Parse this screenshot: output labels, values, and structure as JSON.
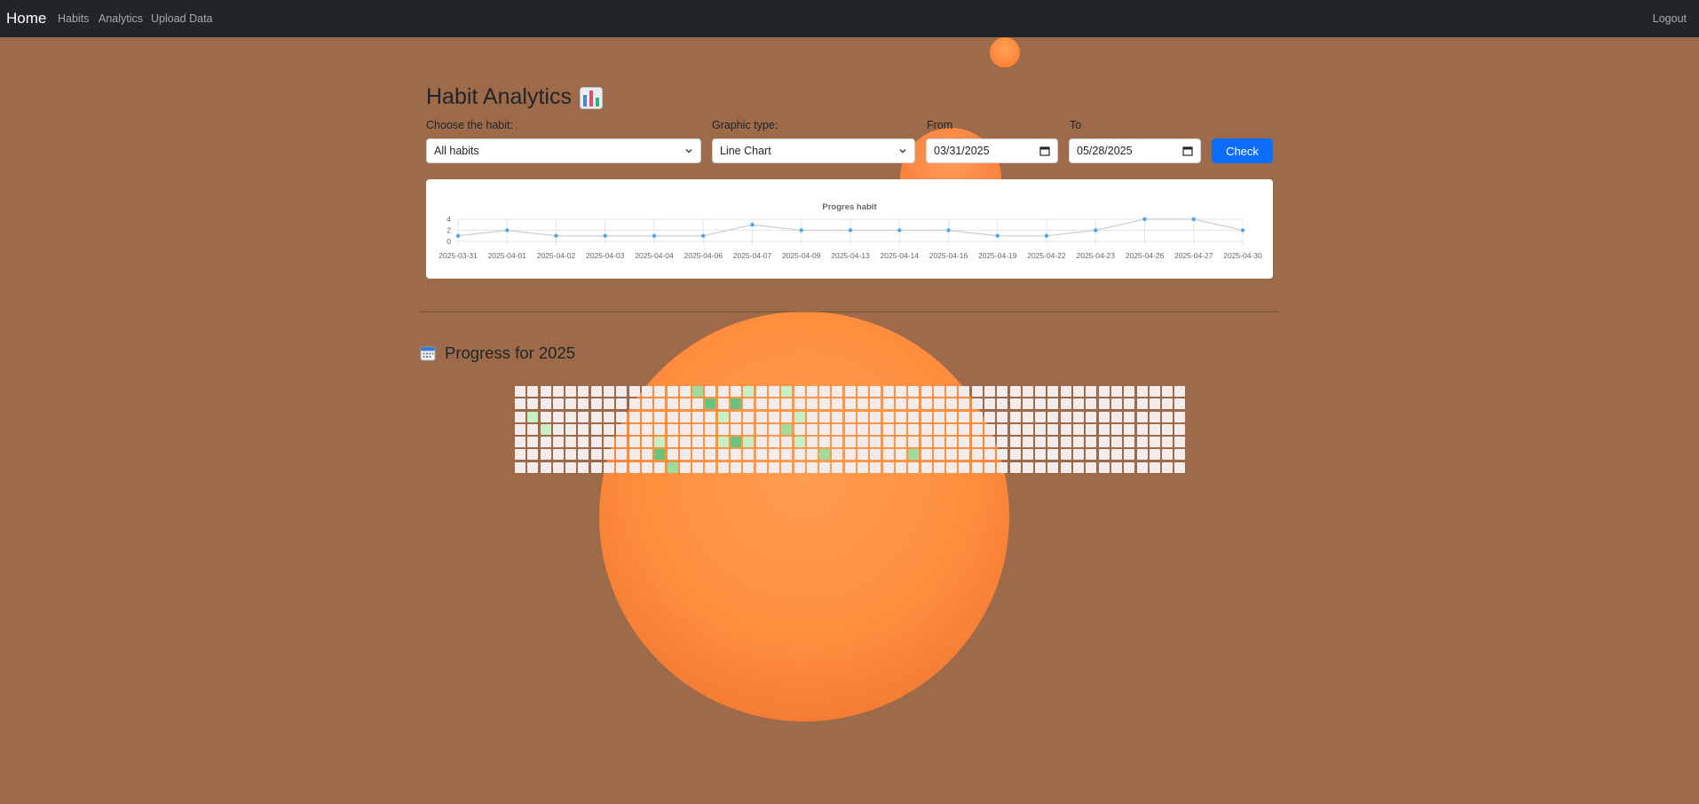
{
  "nav": {
    "brand": "Home",
    "links": [
      "Habits",
      "Analytics",
      "Upload Data"
    ],
    "logout": "Logout"
  },
  "page": {
    "title": "Habit Analytics",
    "title_icon": "bar-chart-emoji-icon"
  },
  "filters": {
    "habit_label": "Choose the habit:",
    "habit_value": "All habits",
    "graphic_label": "Graphic type:",
    "graphic_value": "Line Chart",
    "from_label": "From",
    "from_value": "03/31/2025",
    "to_label": "To",
    "to_value": "05/28/2025",
    "check_label": "Check"
  },
  "chart_data": {
    "type": "line",
    "title": "Progres habit",
    "x": [
      "2025-03-31",
      "2025-04-01",
      "2025-04-02",
      "2025-04-03",
      "2025-04-04",
      "2025-04-06",
      "2025-04-07",
      "2025-04-09",
      "2025-04-13",
      "2025-04-14",
      "2025-04-16",
      "2025-04-19",
      "2025-04-22",
      "2025-04-23",
      "2025-04-26",
      "2025-04-27",
      "2025-04-30"
    ],
    "series": [
      {
        "values": [
          1,
          2,
          1,
          1,
          1,
          1,
          3,
          2,
          2,
          2,
          2,
          1,
          1,
          2,
          4,
          4,
          2
        ]
      }
    ],
    "ylim": [
      0,
      4
    ],
    "yticks": [
      0,
      2,
      4
    ],
    "grid": true,
    "line_color": "#4ea6e6"
  },
  "progress": {
    "title": "Progress for 2025",
    "icon": "calendar-emoji-icon",
    "weeks": 53,
    "level_colors": [
      "#f2ecec",
      "#c6f0c6",
      "#9edc9e",
      "#68c47c"
    ],
    "levels": "0000000001000000010000000000000000000000000000000000000000000000000000000000000001300000002000000020000000300000001010003003001000100000000000000001002000001010000000000000020000000000000000000000000000000000000000000000002000000000000000000000000000000000000000000000000000000000000000000000000000000000000000000000000000000000000000000000000000000000000000000000000000000000000000000000"
  }
}
